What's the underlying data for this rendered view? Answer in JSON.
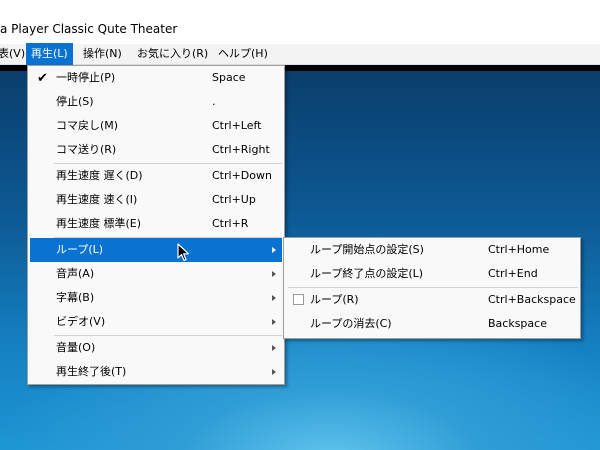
{
  "window": {
    "title": "a Player Classic Qute Theater"
  },
  "menubar": [
    {
      "label": "表(V)"
    },
    {
      "label": "再生(L)"
    },
    {
      "label": "操作(N)"
    },
    {
      "label": "お気に入り(R)"
    },
    {
      "label": "ヘルプ(H)"
    }
  ],
  "playback_menu": {
    "items": [
      {
        "label": "一時停止(P)",
        "shortcut": "Space",
        "checked": true
      },
      {
        "label": "停止(S)",
        "shortcut": "."
      },
      {
        "label": "コマ戻し(M)",
        "shortcut": "Ctrl+Left"
      },
      {
        "label": "コマ送り(R)",
        "shortcut": "Ctrl+Right"
      },
      {
        "label": "再生速度 遅く(D)",
        "shortcut": "Ctrl+Down"
      },
      {
        "label": "再生速度 速く(I)",
        "shortcut": "Ctrl+Up"
      },
      {
        "label": "再生速度 標準(E)",
        "shortcut": "Ctrl+R"
      },
      {
        "label": "ループ(L)",
        "submenu": true
      },
      {
        "label": "音声(A)",
        "submenu": true
      },
      {
        "label": "字幕(B)",
        "submenu": true
      },
      {
        "label": "ビデオ(V)",
        "submenu": true
      },
      {
        "label": "音量(O)",
        "submenu": true
      },
      {
        "label": "再生終了後(T)",
        "submenu": true
      }
    ]
  },
  "loop_submenu": {
    "items": [
      {
        "label": "ループ開始点の設定(S)",
        "shortcut": "Ctrl+Home"
      },
      {
        "label": "ループ終了点の設定(L)",
        "shortcut": "Ctrl+End"
      },
      {
        "label": "ループ(R)",
        "shortcut": "Ctrl+Backspace",
        "checkbox": true,
        "checked": false
      },
      {
        "label": "ループの消去(C)",
        "shortcut": "Backspace"
      }
    ]
  },
  "colors": {
    "highlight": "#0a72d1",
    "menu_bg": "#f9f9f9"
  }
}
